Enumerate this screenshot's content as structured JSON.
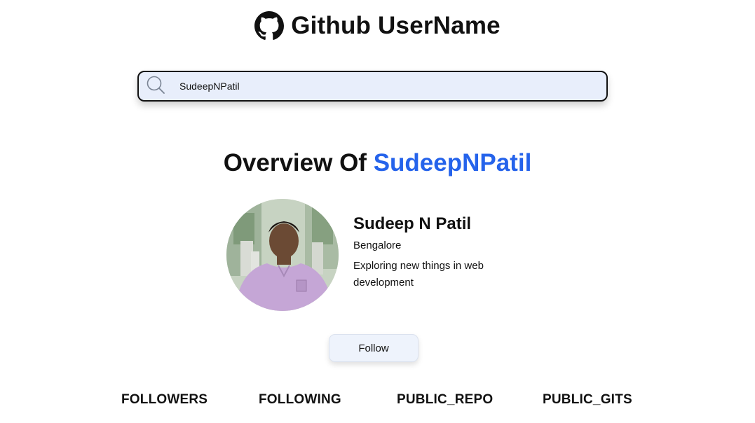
{
  "header": {
    "title": "Github UserName",
    "icon": "github-icon"
  },
  "search": {
    "value": "SudeepNPatil",
    "icon": "search-icon"
  },
  "overview": {
    "prefix": "Overview Of",
    "username": "SudeepNPatil",
    "username_color": "#2563eb"
  },
  "profile": {
    "name": "Sudeep N Patil",
    "location": "Bengalore",
    "bio": "Exploring new things in web development"
  },
  "follow_button": {
    "label": "Follow"
  },
  "stats": [
    {
      "label": "FOLLOWERS"
    },
    {
      "label": "FOLLOWING"
    },
    {
      "label": "PUBLIC_REPO"
    },
    {
      "label": "PUBLIC_GITS"
    }
  ]
}
